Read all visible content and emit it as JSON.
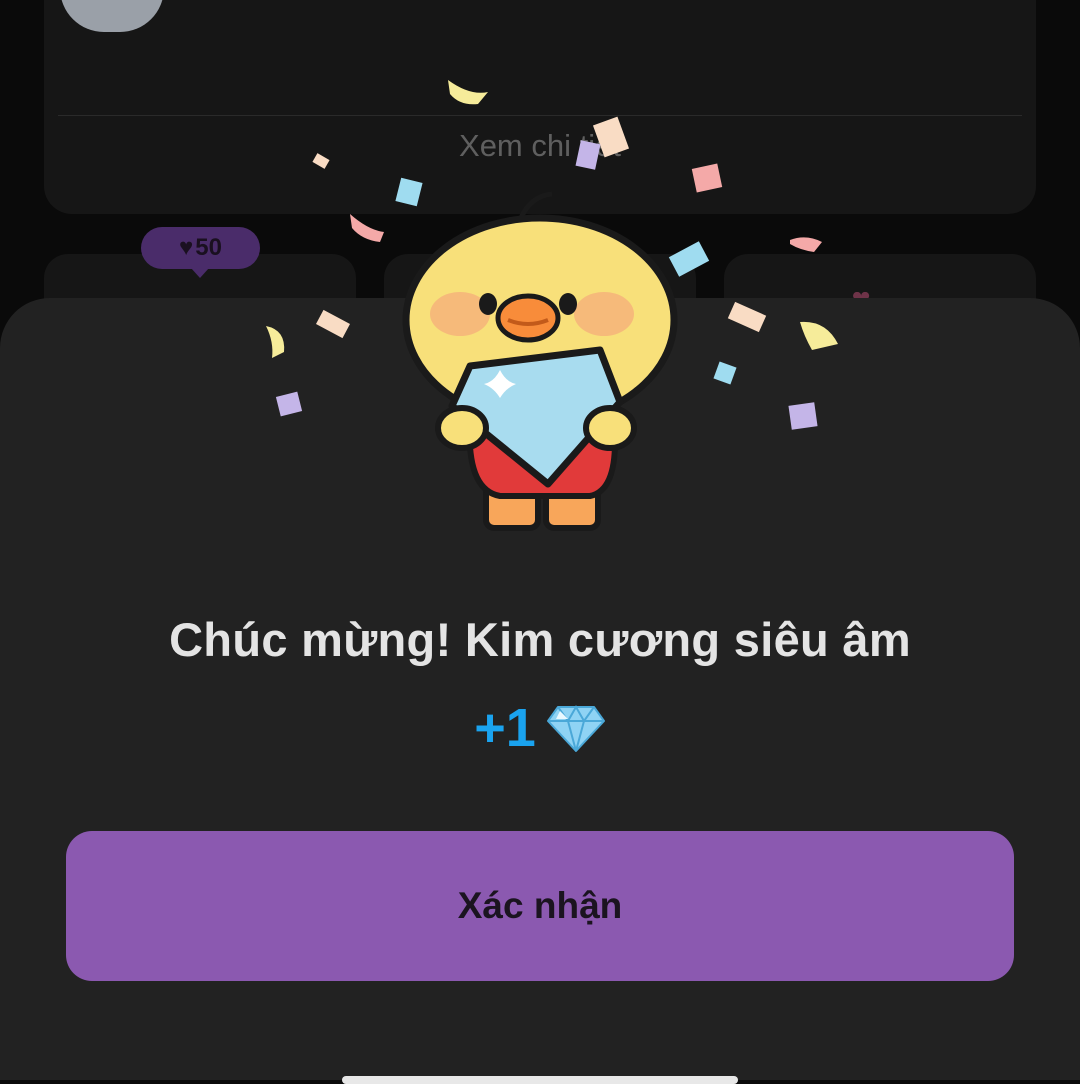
{
  "background": {
    "detail_link": "Xem chi tiết",
    "like_badge": {
      "icon": "heart-icon",
      "count": "50"
    }
  },
  "dialog": {
    "title": "Chúc mừng! Kim cương siêu âm",
    "reward": {
      "amount": "+1",
      "icon": "diamond-icon"
    },
    "confirm_button": "Xác nhận",
    "illustration": "duck-holding-diamond-icon"
  },
  "colors": {
    "sheet": "#222222",
    "accent_button": "#8b59b0",
    "reward_text": "#1aa3ef"
  }
}
